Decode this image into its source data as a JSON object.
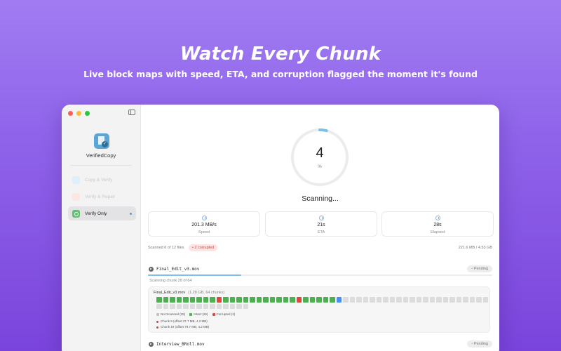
{
  "hero": {
    "title": "Watch Every Chunk",
    "subtitle": "Live block maps with speed, ETA, and corruption flagged the moment it's found"
  },
  "app": {
    "name": "VerifiedCopy"
  },
  "sidebar": {
    "items": [
      {
        "label": "Copy & Verify",
        "state": "disabled",
        "icon": "copy-icon"
      },
      {
        "label": "Verify & Repair",
        "state": "disabled",
        "icon": "repair-icon"
      },
      {
        "label": "Verify Only",
        "state": "active",
        "icon": "verify-icon"
      }
    ]
  },
  "progress": {
    "percent": 4,
    "percent_value": "4",
    "unit": "%",
    "status": "Scanning..."
  },
  "stats": [
    {
      "value": "201.3 MB/s",
      "label": "Speed",
      "icon": "speed-icon"
    },
    {
      "value": "21s",
      "label": "ETA",
      "icon": "clock-icon"
    },
    {
      "value": "28s",
      "label": "Elapsed",
      "icon": "timer-icon"
    }
  ],
  "summary": {
    "scanned": "Scanned 6 of 12 files",
    "corrupted": "2 corrupted",
    "size": "221.6 MB / 4.53 GB"
  },
  "files": [
    {
      "name": "Final_Edit_v3.mov",
      "status": "Pending",
      "progress": 0.27,
      "chunk_status": "Scanning chunk 28 of 64",
      "map_title": "Final_Edit_v3.mov",
      "map_meta": "(1.28 GB, 64 chunks)",
      "chunks": "IIIIIIIIICIIIIIIIIIIICIIIIISNNNNNNNNNNNNNNNNNNNNNNNNNNNNNNNNNNNN",
      "legend": [
        {
          "label": "Not Scanned (35)",
          "color": "#c4c4c6"
        },
        {
          "label": "Intact (26)",
          "color": "#4caf50"
        },
        {
          "label": "Corrupted (2)",
          "color": "#e0463c"
        }
      ],
      "errors": [
        "Chunk 9 (offset 37.7 MB, 4.2 MB)",
        "Chunk 19 (offset 79.7 MB, 4.2 MB)"
      ]
    },
    {
      "name": "Interview_BRoll.mov",
      "status": "Pending"
    }
  ],
  "colors": {
    "intact": "#4caf50",
    "corrupted": "#e0463c",
    "scanning": "#4a8ff0",
    "not_scanned": "#dcdcde",
    "ring": "#7cc0e6"
  }
}
